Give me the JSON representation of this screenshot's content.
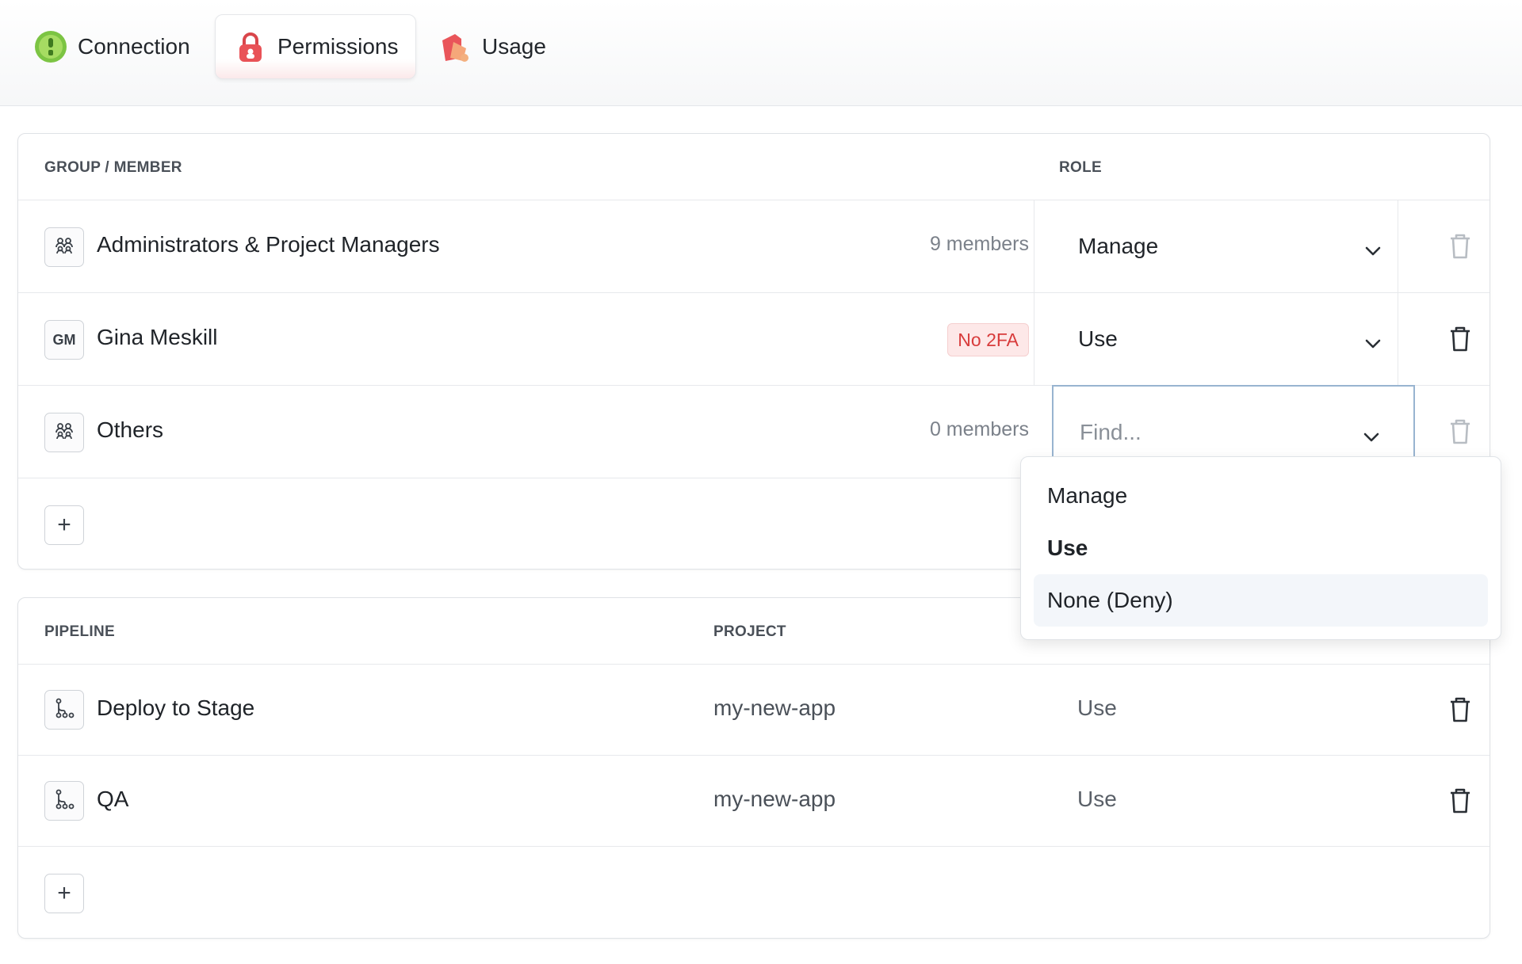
{
  "tabs": [
    {
      "label": "Connection",
      "icon": "plug-icon",
      "active": false
    },
    {
      "label": "Permissions",
      "icon": "lock-icon",
      "active": true
    },
    {
      "label": "Usage",
      "icon": "usage-tag-icon",
      "active": false
    }
  ],
  "members": {
    "header_group": "GROUP / MEMBER",
    "header_role": "ROLE",
    "rows": [
      {
        "avatar": "",
        "avatar_icon": "group-icon",
        "name": "Administrators & Project Managers",
        "meta": "9 members",
        "role": "Manage"
      },
      {
        "avatar": "GM",
        "name": "Gina Meskill",
        "badge": "No 2FA",
        "role": "Use"
      },
      {
        "avatar": "",
        "avatar_icon": "group-icon",
        "name": "Others",
        "meta": "0 members",
        "role_placeholder": "Find..."
      }
    ],
    "add_label": "+"
  },
  "role_dropdown": {
    "options": [
      "Manage",
      "Use",
      "None (Deny)"
    ],
    "selected": "Use",
    "highlighted": "None (Deny)"
  },
  "pipelines": {
    "header_pipeline": "PIPELINE",
    "header_project": "PROJECT",
    "rows": [
      {
        "name": "Deploy to Stage",
        "project": "my-new-app",
        "role": "Use"
      },
      {
        "name": "QA",
        "project": "my-new-app",
        "role": "Use"
      }
    ],
    "add_label": "+"
  },
  "colors": {
    "badge_red": "#d83b3b",
    "focus_border": "#98b4d0",
    "hover_bg": "#f3f6fa"
  }
}
